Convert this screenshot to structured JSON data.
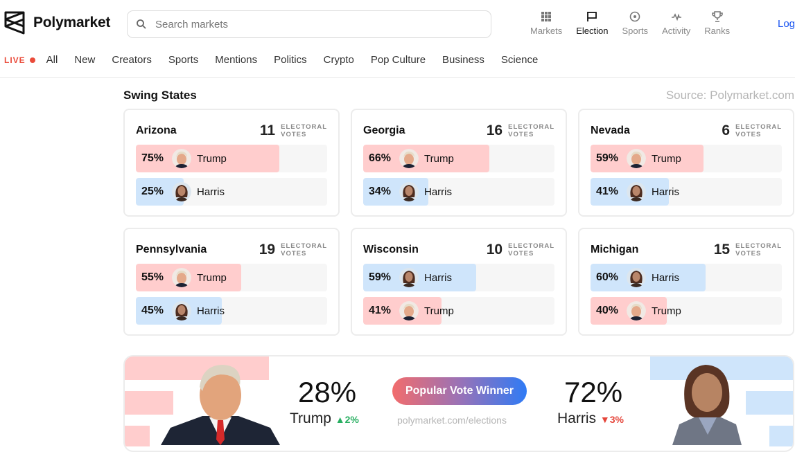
{
  "header": {
    "brand": "Polymarket",
    "search_placeholder": "Search markets",
    "topnav": [
      {
        "label": "Markets",
        "icon": "grid-icon",
        "active": false
      },
      {
        "label": "Election",
        "icon": "flag-icon",
        "active": true
      },
      {
        "label": "Sports",
        "icon": "ball-icon",
        "active": false
      },
      {
        "label": "Activity",
        "icon": "activity-icon",
        "active": false
      },
      {
        "label": "Ranks",
        "icon": "trophy-icon",
        "active": false
      }
    ],
    "login_label": "Log"
  },
  "categories": {
    "live_label": "LIVE",
    "items": [
      "All",
      "New",
      "Creators",
      "Sports",
      "Mentions",
      "Politics",
      "Crypto",
      "Pop Culture",
      "Business",
      "Science"
    ]
  },
  "colors": {
    "trump_fill": "#ffcdcd",
    "harris_fill": "#cfe5fb",
    "live_red": "#ea4b3a",
    "link_blue": "#1652f0"
  },
  "swing": {
    "title": "Swing States",
    "source": "Source: Polymarket.com",
    "ev_label_line1": "ELECTORAL",
    "ev_label_line2": "VOTES",
    "states": [
      {
        "name": "Arizona",
        "ev": "11",
        "rows": [
          {
            "pct": "75%",
            "value": 75,
            "cand": "Trump",
            "party": "trump"
          },
          {
            "pct": "25%",
            "value": 25,
            "cand": "Harris",
            "party": "harris"
          }
        ]
      },
      {
        "name": "Georgia",
        "ev": "16",
        "rows": [
          {
            "pct": "66%",
            "value": 66,
            "cand": "Trump",
            "party": "trump"
          },
          {
            "pct": "34%",
            "value": 34,
            "cand": "Harris",
            "party": "harris"
          }
        ]
      },
      {
        "name": "Nevada",
        "ev": "6",
        "rows": [
          {
            "pct": "59%",
            "value": 59,
            "cand": "Trump",
            "party": "trump"
          },
          {
            "pct": "41%",
            "value": 41,
            "cand": "Harris",
            "party": "harris"
          }
        ]
      },
      {
        "name": "Pennsylvania",
        "ev": "19",
        "rows": [
          {
            "pct": "55%",
            "value": 55,
            "cand": "Trump",
            "party": "trump"
          },
          {
            "pct": "45%",
            "value": 45,
            "cand": "Harris",
            "party": "harris"
          }
        ]
      },
      {
        "name": "Wisconsin",
        "ev": "10",
        "rows": [
          {
            "pct": "59%",
            "value": 59,
            "cand": "Harris",
            "party": "harris"
          },
          {
            "pct": "41%",
            "value": 41,
            "cand": "Trump",
            "party": "trump"
          }
        ]
      },
      {
        "name": "Michigan",
        "ev": "15",
        "rows": [
          {
            "pct": "60%",
            "value": 60,
            "cand": "Harris",
            "party": "harris"
          },
          {
            "pct": "40%",
            "value": 40,
            "cand": "Trump",
            "party": "trump"
          }
        ]
      }
    ]
  },
  "popular": {
    "trump_pct": "28%",
    "trump_name": "Trump",
    "trump_change": "2%",
    "harris_pct": "72%",
    "harris_name": "Harris",
    "harris_change": "3%",
    "badge": "Popular Vote Winner",
    "url": "polymarket.com/elections"
  }
}
